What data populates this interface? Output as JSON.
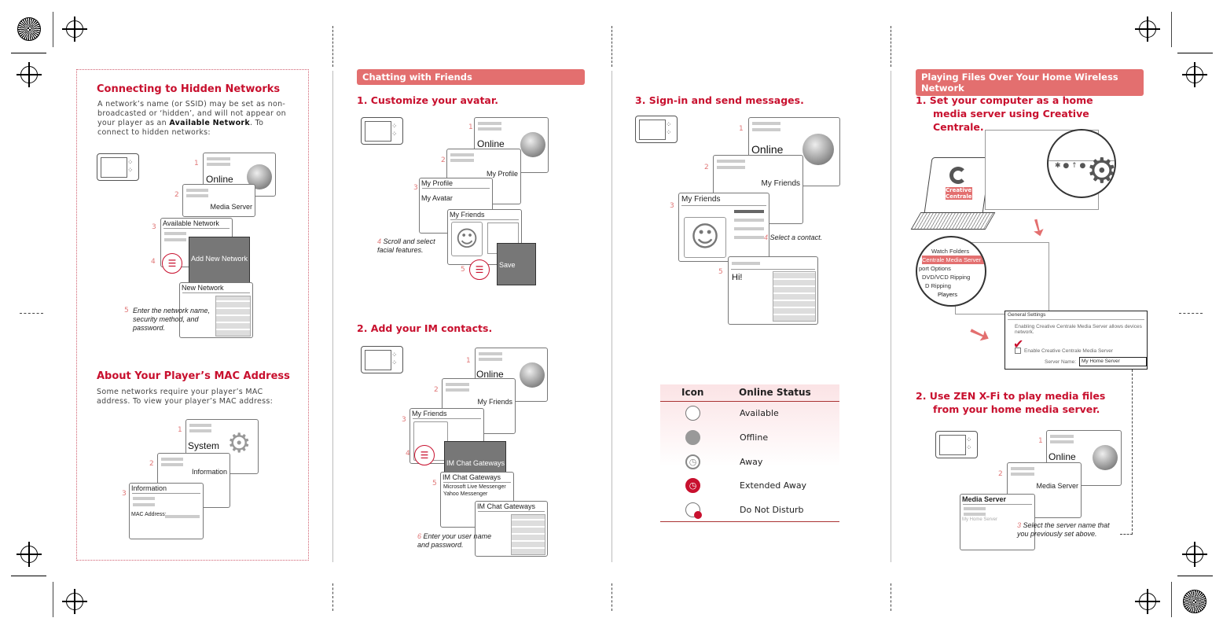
{
  "hidden": {
    "title": "Connecting to Hidden Networks",
    "text1": "A network’s name (or SSID) may be set as non-broadcasted or ‘hidden’, and will not appear on your player as an ",
    "bold": "Available Network",
    "text2": ". To connect to hidden networks:",
    "s1": "Online",
    "s2": "Media Server",
    "s3": "Available Network",
    "s4": "Add New Network",
    "s5": "New Network",
    "note5": "Enter the network name, security method, and password."
  },
  "mac": {
    "title": "About Your Player’s MAC Address",
    "text": "Some networks require your player’s MAC address. To view your player’s MAC address:",
    "s1": "System",
    "s2": "Information",
    "s3": "Information",
    "mac_label": "MAC Address:"
  },
  "chat": {
    "header": "Chatting with Friends",
    "step1": "1.  Customize your avatar.",
    "a1": "Online",
    "a2": "My Profile",
    "a3": "My Profile",
    "a3b": "My Avatar",
    "a4": "My Friends",
    "note4": "Scroll and select facial features.",
    "a5": "Save",
    "step2": "2.  Add your IM contacts.",
    "b1": "Online",
    "b2": "My Friends",
    "b3": "My Friends",
    "b4": "IM Chat Gateways",
    "b5": "IM Chat Gateways",
    "b5a": "Microsoft Live Messenger",
    "b5b": "Yahoo Messenger",
    "b6": "IM Chat Gateways",
    "note6": "Enter your user name and password.",
    "step3": "3.  Sign-in and send messages.",
    "c1": "Online",
    "c2": "My Friends",
    "c3": "My Friends",
    "note4c": "Select a contact.",
    "c5": "Hi!"
  },
  "status_table": {
    "headers": [
      "Icon",
      "Online Status"
    ],
    "rows": [
      {
        "icon": "available-icon",
        "label": "Available"
      },
      {
        "icon": "offline-icon",
        "label": "Offline"
      },
      {
        "icon": "away-icon",
        "label": "Away"
      },
      {
        "icon": "extended-away-icon",
        "label": "Extended Away"
      },
      {
        "icon": "do-not-disturb-icon",
        "label": "Do Not Disturb"
      }
    ]
  },
  "home": {
    "header": "Playing Files Over Your Home Wireless Network",
    "step1": "1.  Set your computer as a home media server using Creative Centrale.",
    "app_label": "Creative Centrale",
    "menu": [
      "Watch Folders",
      "Centrale Media Server",
      "port Options",
      "DVD/VCD Ripping",
      "D Ripping",
      "Players"
    ],
    "gs_title": "General Settings",
    "gs_text": "Enabling Creative Centrale Media Server allows devices network.",
    "gs_check": "Enable Creative Centrale Media Server",
    "gs_name_label": "Server Name:",
    "gs_name_value": "My Home Server",
    "step2": "2.  Use ZEN X-Fi to play media files from your home media server.",
    "d1": "Online",
    "d2": "Media Server",
    "d3": "Media Server",
    "d3v": "My Home Server",
    "note3": "Select the server name that you previously set above."
  },
  "nums": [
    "1",
    "2",
    "3",
    "4",
    "5",
    "6"
  ],
  "colors": {
    "accent": "#c8102e",
    "header_bar": "#e36f6f"
  }
}
